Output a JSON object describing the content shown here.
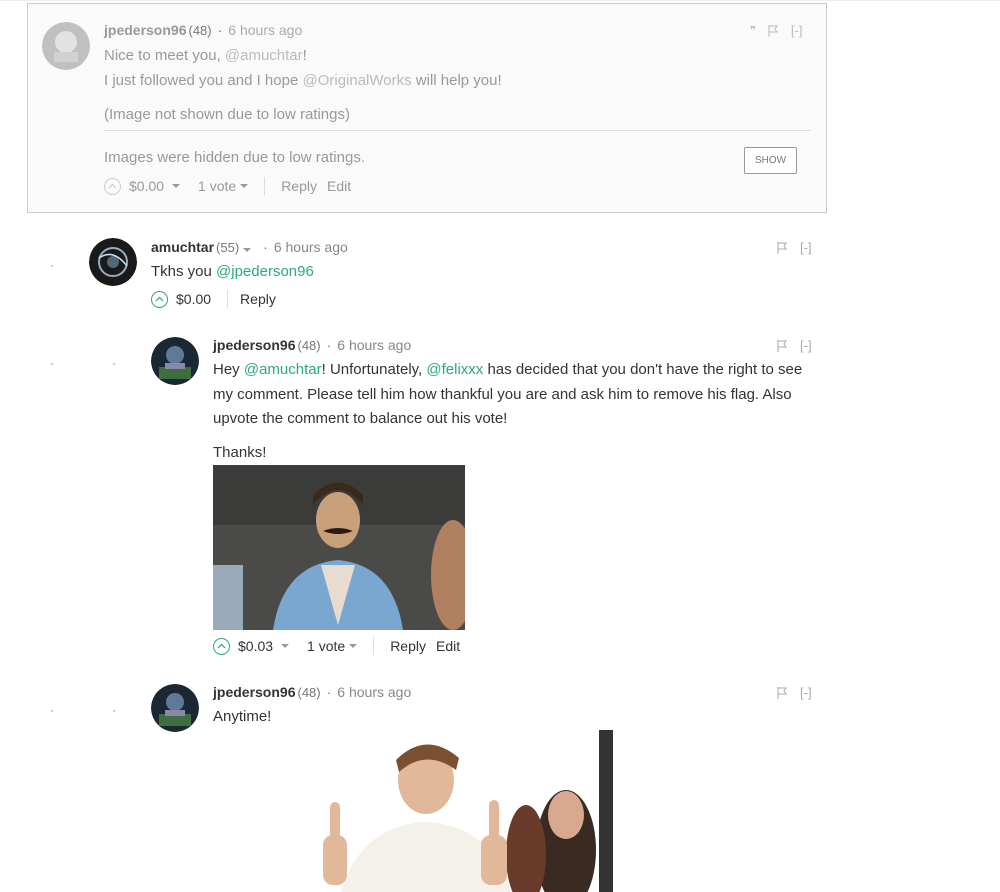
{
  "comments": [
    {
      "author": "jpederson96",
      "rep": "(48)",
      "time": "6 hours ago",
      "flag_label": "[-]",
      "line1_pre": "Nice to meet you, ",
      "line1_mention": "@amuchtar",
      "line1_post": "!",
      "line2_pre": "I just followed you and I hope ",
      "line2_mention": "@OriginalWorks",
      "line2_post": " will help you!",
      "hidden_image_note": "(Image not shown due to low ratings)",
      "hidden_notice": "Images were hidden due to low ratings.",
      "show_button": "SHOW",
      "payout": "$0.00",
      "votes": "1 vote",
      "reply": "Reply",
      "edit": "Edit"
    },
    {
      "author": "amuchtar",
      "rep": "(55)",
      "time": "6 hours ago",
      "flag_label": "[-]",
      "text_pre": "Tkhs you ",
      "text_mention": "@jpederson96",
      "payout": "$0.00",
      "reply": "Reply"
    },
    {
      "author": "jpederson96",
      "rep": "(48)",
      "time": "6 hours ago",
      "flag_label": "[-]",
      "p1_a": "Hey ",
      "p1_m1": "@amuchtar",
      "p1_b": "! Unfortunately, ",
      "p1_m2": "@felixxx",
      "p1_c": " has decided that you don't have the right to see my comment. Please tell him how thankful you are and ask him to remove his flag. Also upvote the comment to balance out his vote!",
      "p2": "Thanks!",
      "payout": "$0.03",
      "votes": "1 vote",
      "reply": "Reply",
      "edit": "Edit"
    },
    {
      "author": "jpederson96",
      "rep": "(48)",
      "time": "6 hours ago",
      "flag_label": "[-]",
      "text": "Anytime!"
    }
  ],
  "dot": "·",
  "colors": {
    "accent": "#2ba880",
    "muted": "#999999",
    "border": "#cccccc"
  },
  "icons": [
    "flag-icon",
    "upvote-chevron-icon",
    "caret-down-icon",
    "quote-icon"
  ]
}
